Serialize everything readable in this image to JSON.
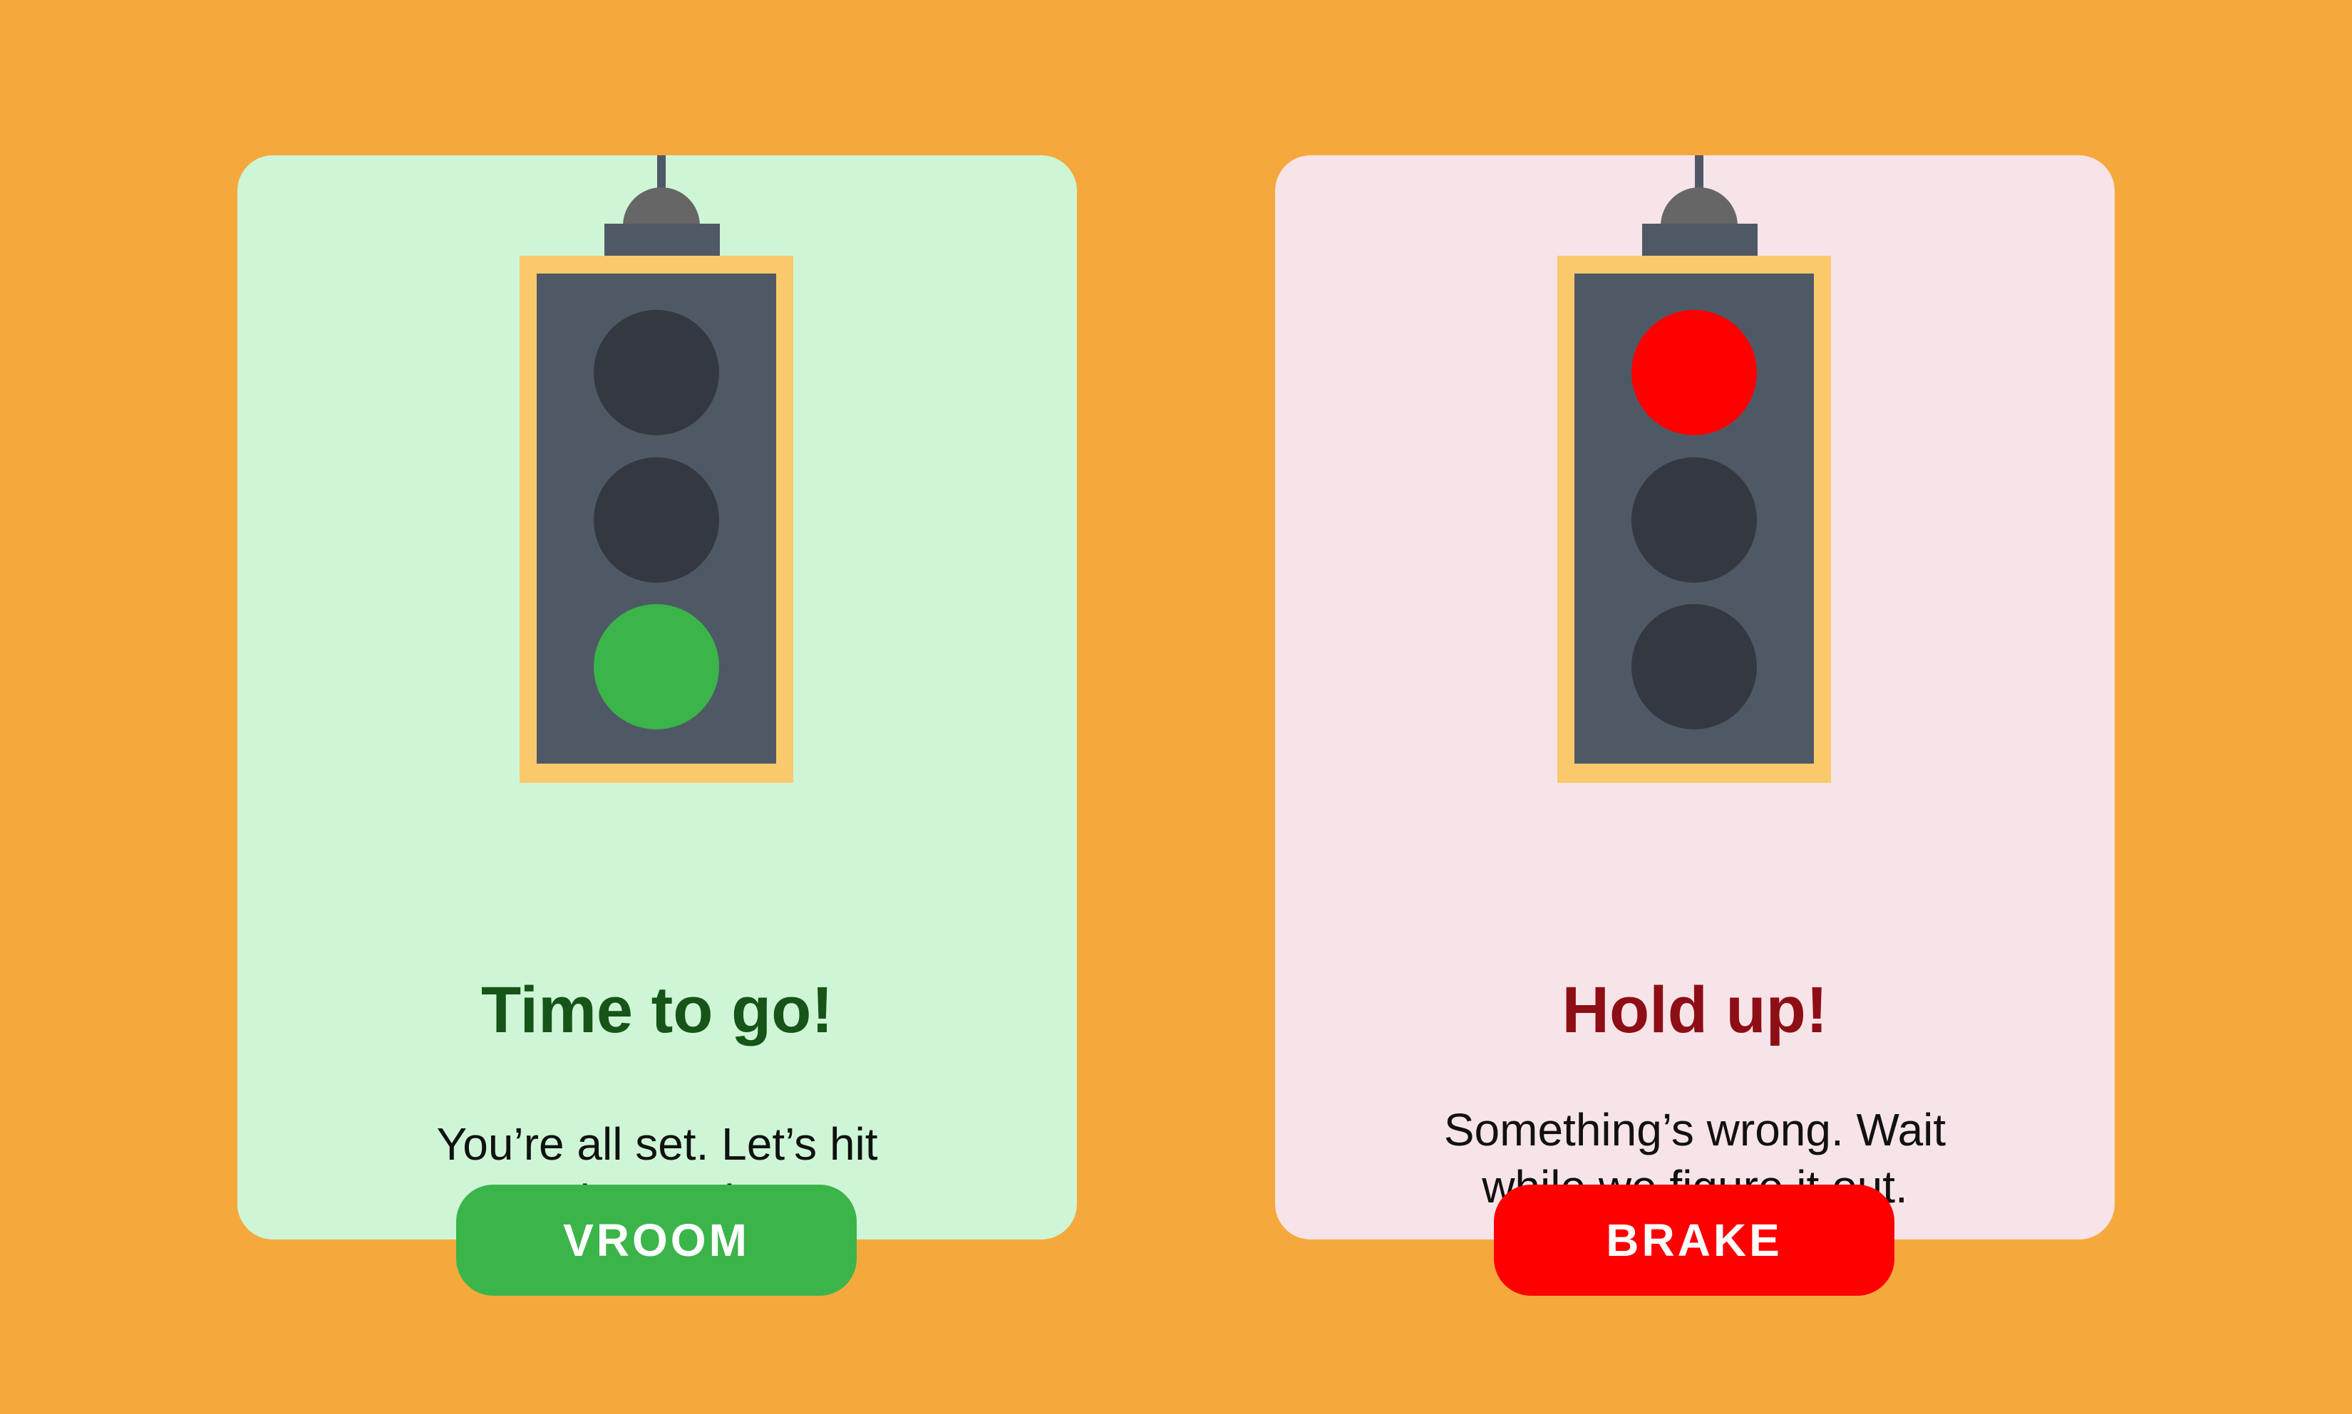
{
  "cards": {
    "go": {
      "title": "Time to go!",
      "message": "You’re all set. Let’s hit the road!",
      "button_label": "VROOM",
      "active_light": "green",
      "card_color": "#CEF6D6",
      "title_color": "#165418",
      "button_color": "#3BB54A",
      "light_color": "#3BB54A"
    },
    "stop": {
      "title": "Hold up!",
      "message": "Something’s wrong. Wait while we figure it out.",
      "button_label": "BRAKE",
      "active_light": "red",
      "card_color": "#F7E4E8",
      "title_color": "#8E0E16",
      "button_color": "#FF0000",
      "light_color": "#FF0000"
    }
  },
  "colors": {
    "background": "#F5A93C",
    "signal_frame": "#F9C96C",
    "signal_body": "#4F5966",
    "lamp_off": "#343840",
    "cap": "#666666"
  },
  "icons": [
    "traffic-light-icon"
  ]
}
